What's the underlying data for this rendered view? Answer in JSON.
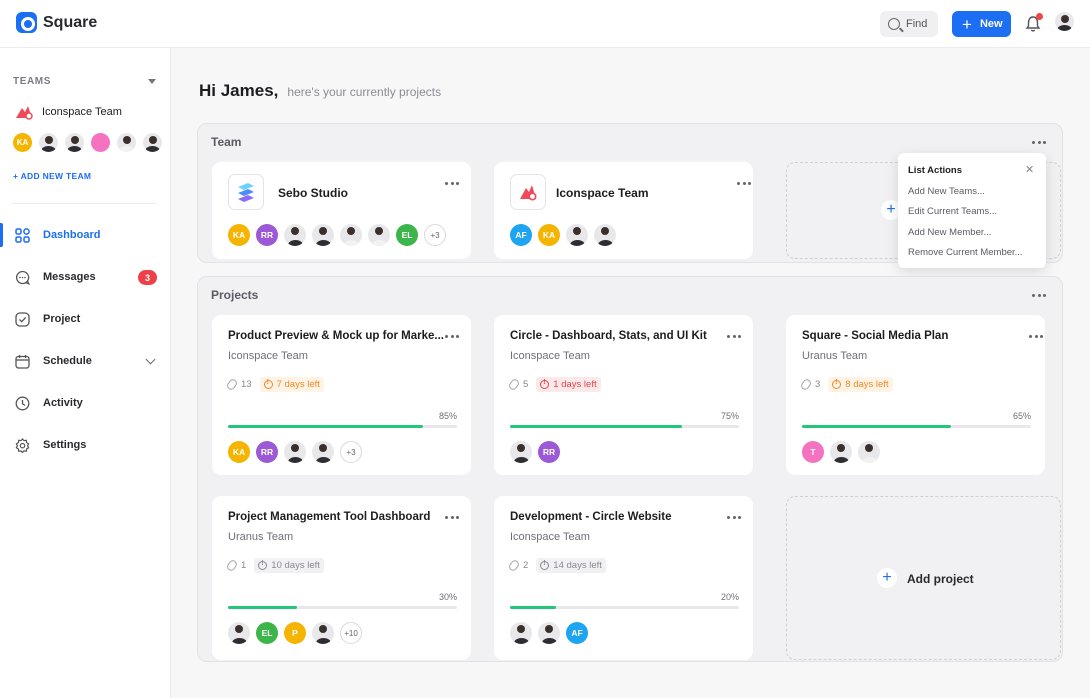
{
  "app": {
    "name": "Square"
  },
  "topbar": {
    "find_label": "Find",
    "new_label": "New",
    "new_icon": "plus-icon",
    "bell_icon": "bell-icon"
  },
  "sidebar": {
    "teams_heading": "TEAMS",
    "current_team": "Iconspace Team",
    "team_members": [
      {
        "initials": "KA",
        "color": "#f5b400"
      },
      {
        "photo": true
      },
      {
        "photo": true
      },
      {
        "initials": "",
        "color": "#f472c0"
      },
      {
        "photo": true,
        "light": true
      },
      {
        "photo": true
      }
    ],
    "add_team_label": "+ ADD NEW TEAM",
    "nav": [
      {
        "label": "Dashboard",
        "icon": "grid-icon",
        "active": true
      },
      {
        "label": "Messages",
        "icon": "chat-icon",
        "badge": "3"
      },
      {
        "label": "Project",
        "icon": "checkbox-icon"
      },
      {
        "label": "Schedule",
        "icon": "calendar-icon",
        "chevron": true
      },
      {
        "label": "Activity",
        "icon": "clock-icon"
      },
      {
        "label": "Settings",
        "icon": "gear-icon"
      }
    ]
  },
  "greeting": {
    "hi": "Hi James,",
    "sub": "here's your currently projects"
  },
  "team_panel": {
    "title": "Team",
    "cards": [
      {
        "name": "Sebo Studio",
        "members": [
          {
            "initials": "KA",
            "color": "#f5b400"
          },
          {
            "initials": "RR",
            "color": "#9b59d6"
          },
          {
            "photo": true
          },
          {
            "photo": true
          },
          {
            "photo": true,
            "light": true
          },
          {
            "photo": true,
            "light": true
          },
          {
            "initials": "EL",
            "color": "#3cb64a"
          },
          {
            "more": "+3"
          }
        ]
      },
      {
        "name": "Iconspace Team",
        "members": [
          {
            "initials": "AF",
            "color": "#1ea4f0"
          },
          {
            "initials": "KA",
            "color": "#f5b400"
          },
          {
            "photo": true
          },
          {
            "photo": true
          }
        ]
      }
    ]
  },
  "list_actions": {
    "title": "List Actions",
    "items": [
      "Add New Teams...",
      "Edit Current Teams...",
      "Add New Member...",
      "Remove Current Member..."
    ]
  },
  "projects_panel": {
    "title": "Projects",
    "add_project_label": "Add project",
    "projects": [
      {
        "title": "Product Preview & Mock up for Marke...",
        "team": "Iconspace Team",
        "files": "13",
        "due": "7 days left",
        "due_style": "orange",
        "percent_label": "85%",
        "progress": 0.85,
        "members": [
          {
            "initials": "KA",
            "color": "#f5b400"
          },
          {
            "initials": "RR",
            "color": "#9b59d6"
          },
          {
            "photo": true
          },
          {
            "photo": true
          },
          {
            "more": "+3"
          }
        ]
      },
      {
        "title": "Circle - Dashboard, Stats, and UI Kit",
        "team": "Iconspace Team",
        "files": "5",
        "due": "1 days left",
        "due_style": "red",
        "percent_label": "75%",
        "progress": 0.75,
        "members": [
          {
            "photo": true
          },
          {
            "initials": "RR",
            "color": "#9b59d6"
          }
        ]
      },
      {
        "title": "Square - Social Media Plan",
        "team": "Uranus Team",
        "files": "3",
        "due": "8 days left",
        "due_style": "orange",
        "percent_label": "65%",
        "progress": 0.65,
        "members": [
          {
            "initials": "T",
            "color": "#f472c0"
          },
          {
            "photo": true
          },
          {
            "photo": true,
            "light": true
          }
        ]
      },
      {
        "title": "Project Management Tool Dashboard",
        "team": "Uranus Team",
        "files": "1",
        "due": "10 days left",
        "due_style": "gray",
        "percent_label": "30%",
        "progress": 0.3,
        "members": [
          {
            "photo": true
          },
          {
            "initials": "EL",
            "color": "#3cb64a"
          },
          {
            "initials": "P",
            "color": "#f5b400"
          },
          {
            "photo": true
          },
          {
            "more": "+10"
          }
        ]
      },
      {
        "title": "Development - Circle Website",
        "team": "Iconspace Team",
        "files": "2",
        "due": "14 days left",
        "due_style": "gray",
        "percent_label": "20%",
        "progress": 0.2,
        "members": [
          {
            "photo": true
          },
          {
            "photo": true
          },
          {
            "initials": "AF",
            "color": "#1ea4f0"
          }
        ]
      }
    ]
  }
}
